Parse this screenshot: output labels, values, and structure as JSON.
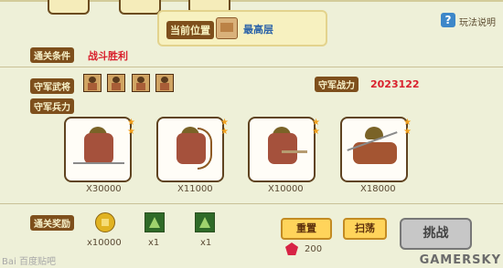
{
  "header": {
    "location_label": "当前位置",
    "location_value": "最高层",
    "help_symbol": "?",
    "help_text": "玩法说明"
  },
  "sections": {
    "clear_condition_label": "通关条件",
    "clear_condition_value": "战斗胜利",
    "defender_generals_label": "守军武将",
    "defender_power_label": "守军战力",
    "defender_power_value": "2023122",
    "defender_troops_label": "守军兵力"
  },
  "units": [
    {
      "name": "spear infantry",
      "count": "X30000",
      "stars": 2
    },
    {
      "name": "archer",
      "count": "X11000",
      "stars": 2
    },
    {
      "name": "musketeer",
      "count": "X10000",
      "stars": 2
    },
    {
      "name": "cavalry",
      "count": "X18000",
      "stars": 2
    }
  ],
  "rewards": {
    "label": "通关奖励",
    "items": [
      {
        "icon": "coin-icon",
        "amount": "x10000"
      },
      {
        "icon": "tower-icon",
        "amount": "x1"
      },
      {
        "icon": "tower-icon",
        "amount": "x1"
      }
    ]
  },
  "actions": {
    "reset": "重置",
    "sweep": "扫荡",
    "challenge": "挑战",
    "ruby_cost": "200"
  },
  "watermarks": {
    "left": "Bai 百度贴吧",
    "right": "GAMERSKY"
  }
}
